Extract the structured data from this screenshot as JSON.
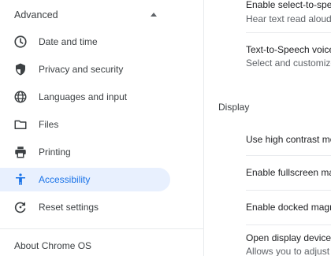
{
  "sidebar": {
    "advanced_label": "Advanced",
    "items": [
      {
        "label": "Date and time",
        "icon": "clock-icon"
      },
      {
        "label": "Privacy and security",
        "icon": "shield-icon"
      },
      {
        "label": "Languages and input",
        "icon": "globe-icon"
      },
      {
        "label": "Files",
        "icon": "folder-icon"
      },
      {
        "label": "Printing",
        "icon": "printer-icon"
      },
      {
        "label": "Accessibility",
        "icon": "accessibility-icon",
        "active": true
      },
      {
        "label": "Reset settings",
        "icon": "reset-icon"
      }
    ],
    "about_label": "About Chrome OS"
  },
  "main": {
    "rows_top": [
      {
        "title": "Enable select-to-speak",
        "subtitle": "Hear text read aloud"
      },
      {
        "title": "Text-to-Speech voice settings",
        "subtitle": "Select and customize"
      }
    ],
    "display_section": {
      "title": "Display",
      "rows": [
        {
          "title": "Use high contrast mode"
        },
        {
          "title": "Enable fullscreen magnifier"
        },
        {
          "title": "Enable docked magnifier"
        },
        {
          "title": "Open display device settings",
          "subtitle": "Allows you to adjust"
        }
      ]
    }
  },
  "colors": {
    "accent": "#1a73e8",
    "active_bg": "#e8f0fe",
    "icon": "#3c4043",
    "divider": "#e8eaed"
  }
}
